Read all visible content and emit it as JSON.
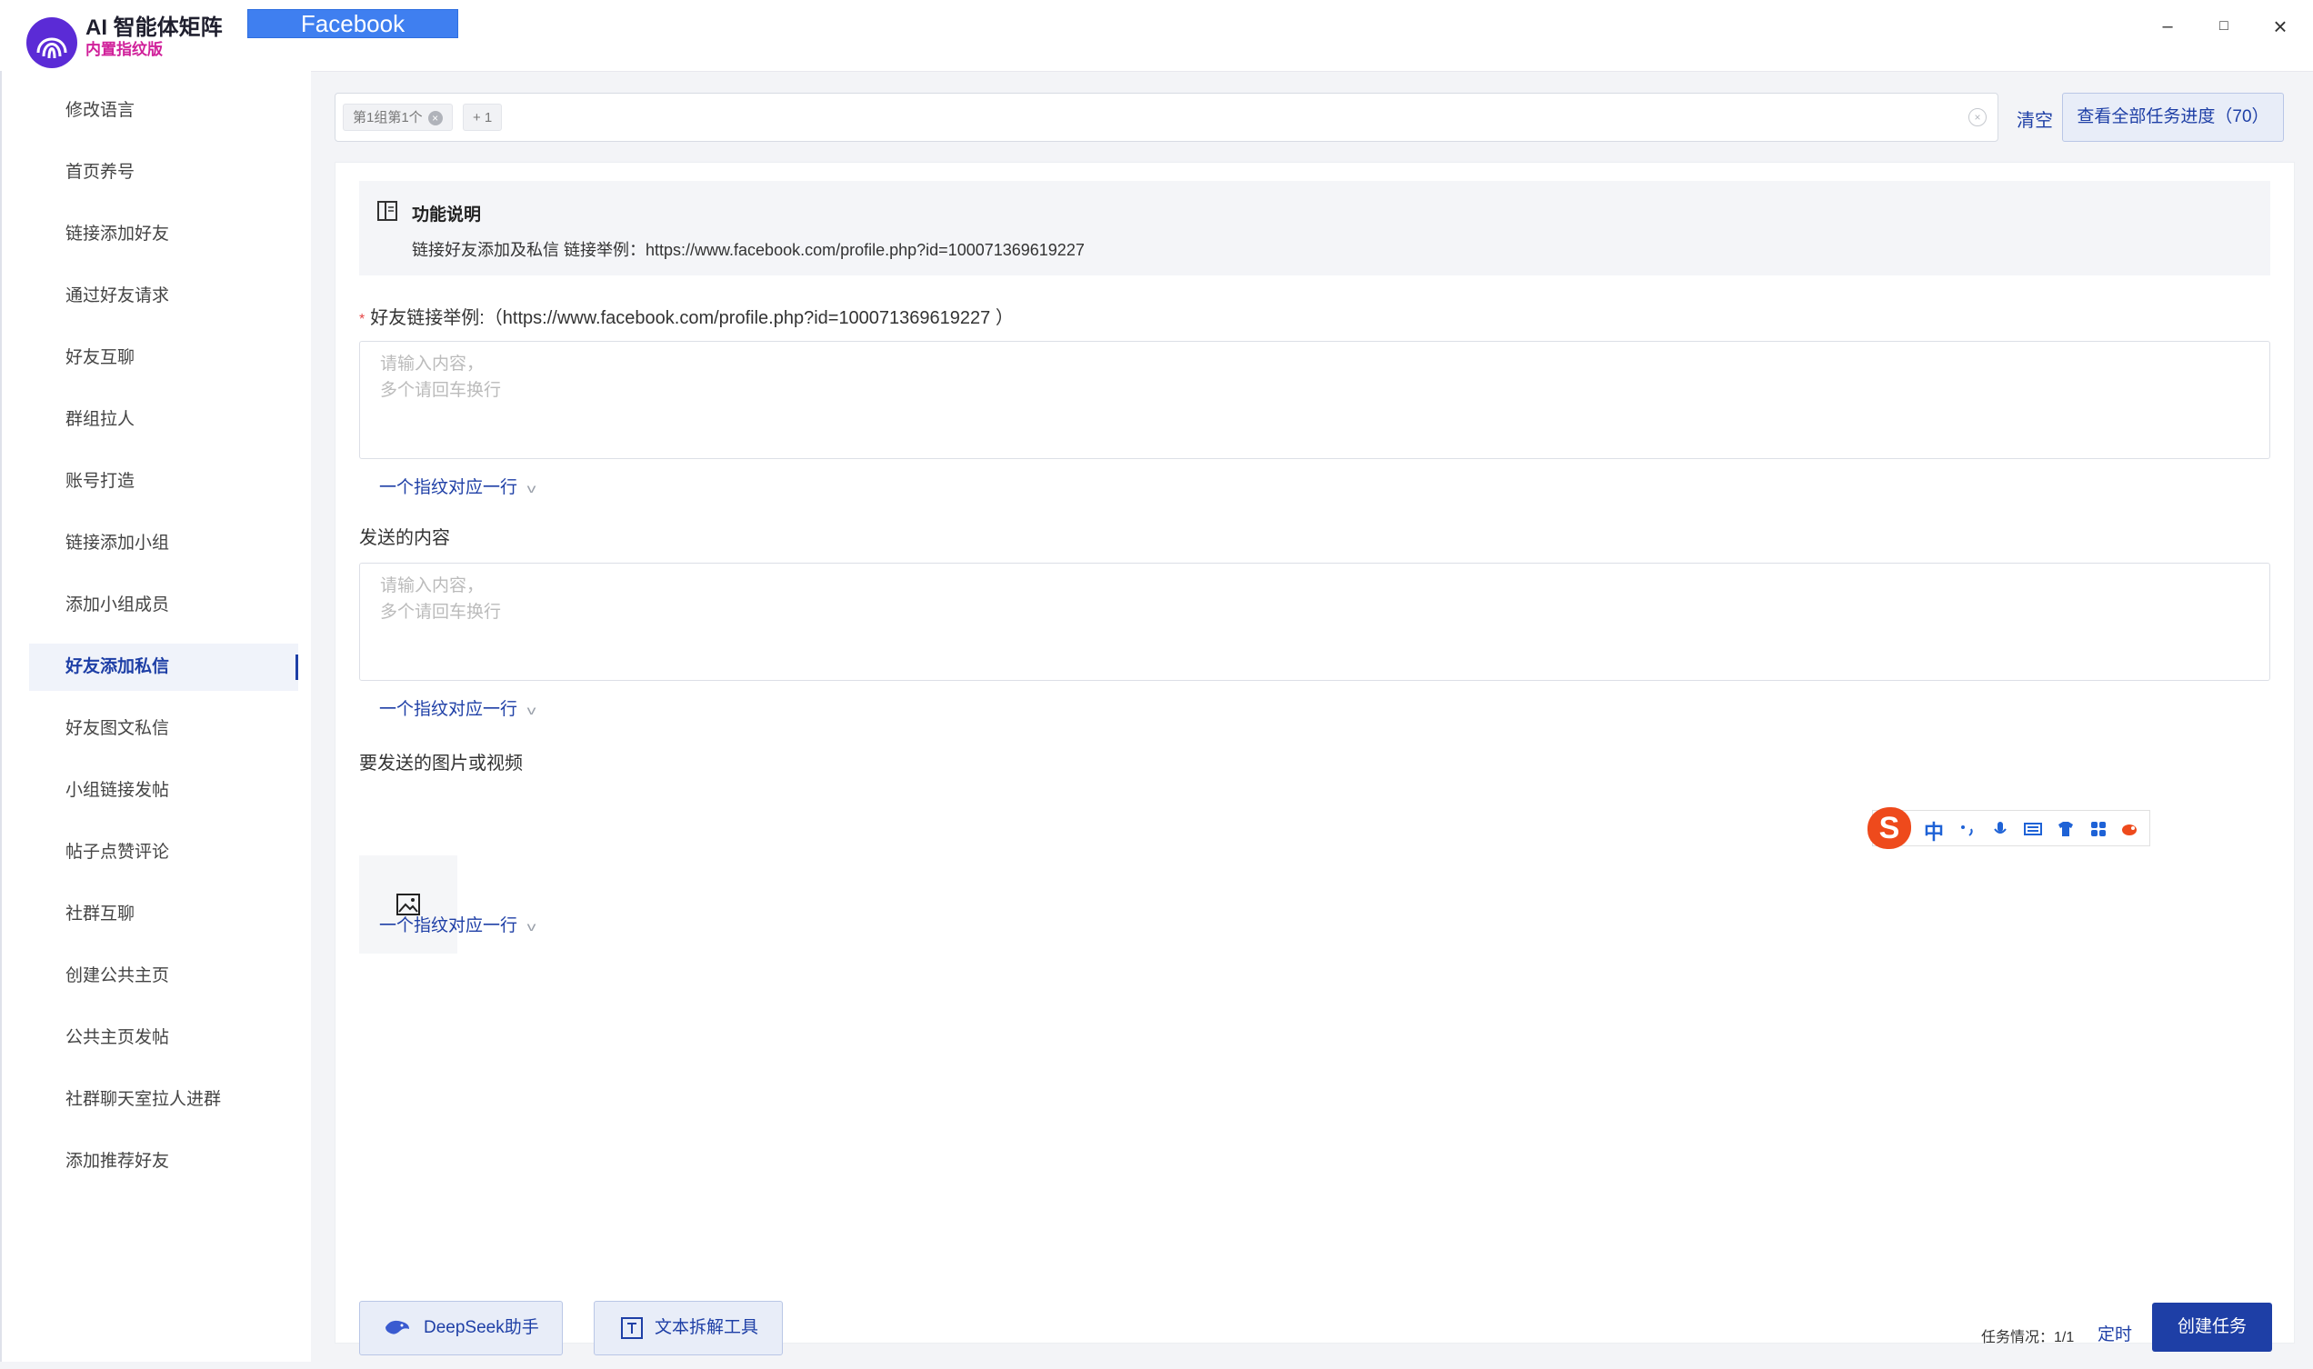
{
  "app": {
    "title": "AI 智能体矩阵",
    "subtitle": "内置指纹版",
    "platform_tab": "Facebook"
  },
  "window_controls": {
    "minimize": "–",
    "maximize": "□",
    "close": "×"
  },
  "sidebar": {
    "items": [
      {
        "label": "修改语言"
      },
      {
        "label": "首页养号"
      },
      {
        "label": "链接添加好友"
      },
      {
        "label": "通过好友请求"
      },
      {
        "label": "好友互聊"
      },
      {
        "label": "群组拉人"
      },
      {
        "label": "账号打造"
      },
      {
        "label": "链接添加小组"
      },
      {
        "label": "添加小组成员"
      },
      {
        "label": "好友添加私信"
      },
      {
        "label": "好友图文私信"
      },
      {
        "label": "小组链接发帖"
      },
      {
        "label": "帖子点赞评论"
      },
      {
        "label": "社群互聊"
      },
      {
        "label": "创建公共主页"
      },
      {
        "label": "公共主页发帖"
      },
      {
        "label": "社群聊天室拉人进群"
      },
      {
        "label": "添加推荐好友"
      }
    ],
    "active_index": 9
  },
  "selector": {
    "tag1": "第1组第1个",
    "tag_more": "+ 1",
    "clear_label": "清空",
    "progress_button": "查看全部任务进度（70）"
  },
  "notice": {
    "title": "功能说明",
    "text": "链接好友添加及私信 链接举例：https://www.facebook.com/profile.php?id=100071369619227"
  },
  "form": {
    "friend_link_label": "好友链接举例:（https://www.facebook.com/profile.php?id=100071369619227 ）",
    "friend_link_placeholder": "请输入内容，\n多个请回车换行",
    "content_label": "发送的内容",
    "content_placeholder": "请输入内容，\n多个请回车换行",
    "media_label": "要发送的图片或视频",
    "mode_label": "一个指纹对应一行"
  },
  "ime": {
    "logo": "S",
    "lang": "中"
  },
  "footer": {
    "deepseek_button": "DeepSeek助手",
    "text_tool_button": "文本拆解工具",
    "task_status": "任务情况：1/1",
    "timer_label": "定时",
    "create_button": "创建任务"
  },
  "colors": {
    "accent": "#1e3fa6",
    "platform_tab": "#3f7ff0",
    "subtitle": "#d0209a",
    "ime": "#ee4a1c"
  }
}
